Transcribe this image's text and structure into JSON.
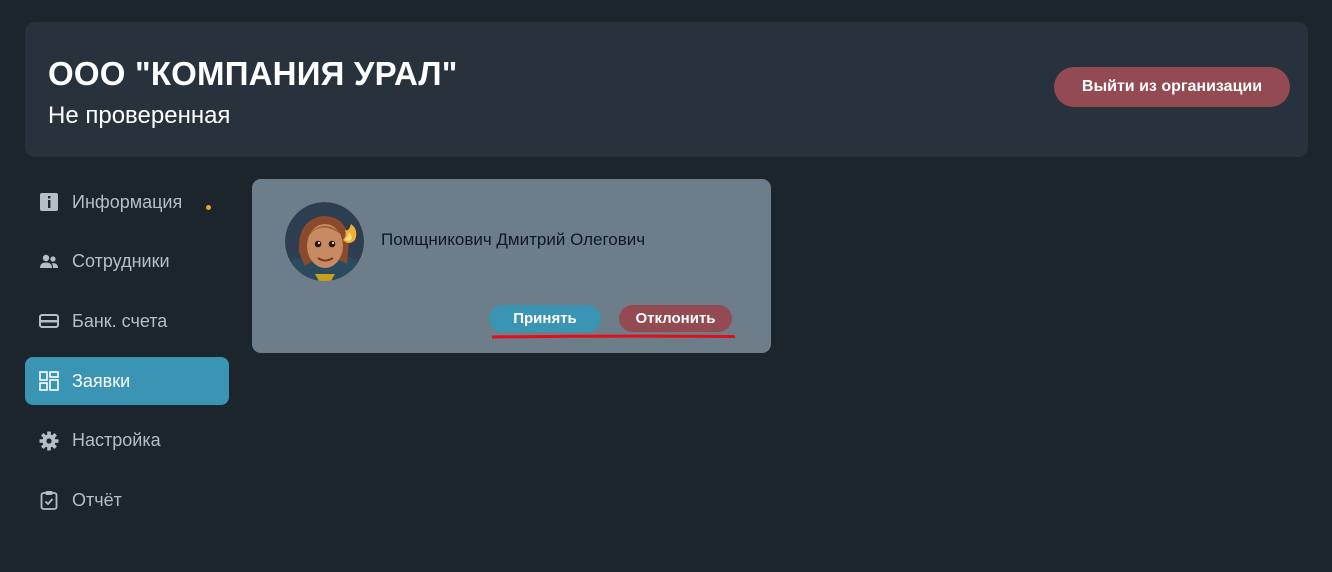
{
  "header": {
    "org_name": "ООО \"КОМПАНИЯ УРАЛ\"",
    "org_status": "Не проверенная",
    "leave_label": "Выйти из организации"
  },
  "sidebar": {
    "items": [
      {
        "label": "Информация",
        "icon": "info-icon",
        "has_dot": true
      },
      {
        "label": "Сотрудники",
        "icon": "people-icon"
      },
      {
        "label": "Банк. счета",
        "icon": "card-icon"
      },
      {
        "label": "Заявки",
        "icon": "grid-icon",
        "active": true
      },
      {
        "label": "Настройка",
        "icon": "gear-icon"
      },
      {
        "label": "Отчёт",
        "icon": "clipboard-icon"
      }
    ]
  },
  "request": {
    "name": "Помщникович Дмитрий Олегович",
    "accept_label": "Принять",
    "reject_label": "Отклонить"
  },
  "colors": {
    "background": "#1d252c",
    "panel": "#28323c",
    "accent": "#3a94b3",
    "danger": "#934a52",
    "card": "#6d7d8a",
    "dot": "#f0a030",
    "annotation": "#e0101a"
  }
}
